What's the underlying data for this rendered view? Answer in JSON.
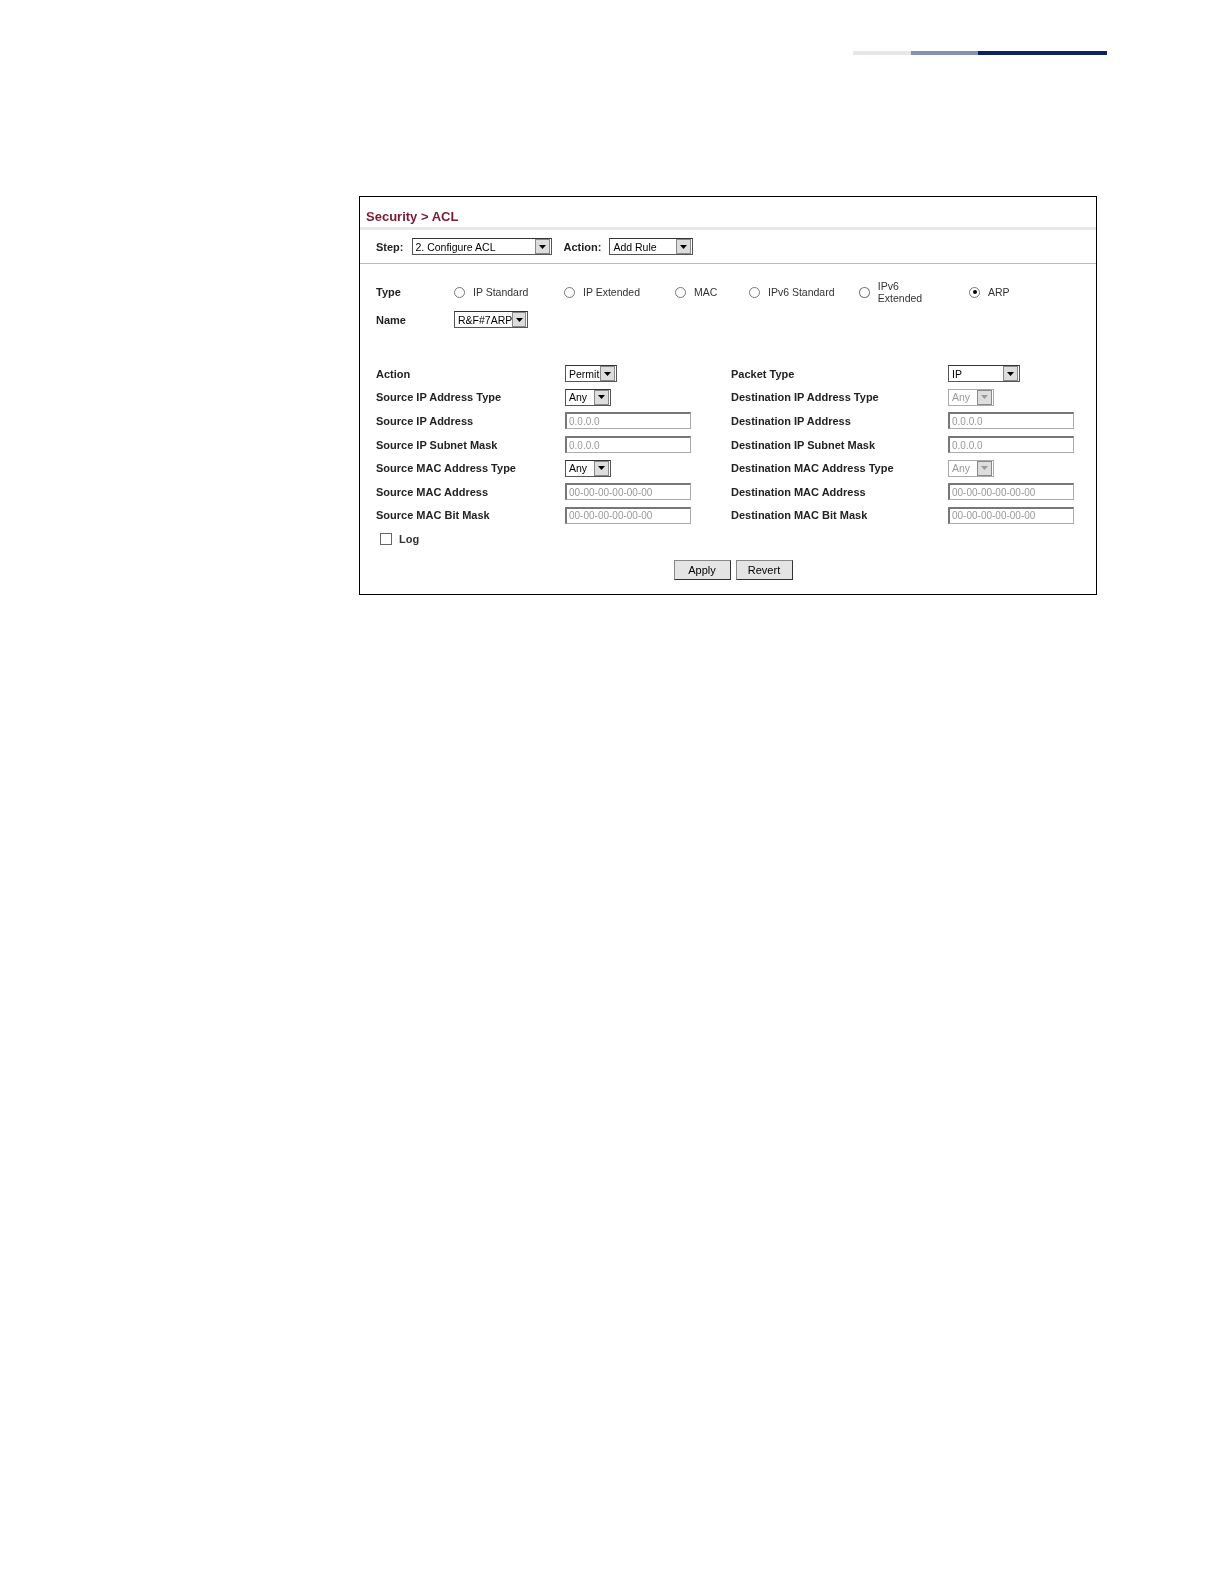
{
  "title": "Security > ACL",
  "step": {
    "label": "Step:",
    "value": "2. Configure ACL"
  },
  "action": {
    "label": "Action:",
    "value": "Add Rule"
  },
  "type": {
    "label": "Type",
    "options": [
      {
        "label": "IP Standard",
        "selected": false
      },
      {
        "label": "IP Extended",
        "selected": false
      },
      {
        "label": "MAC",
        "selected": false
      },
      {
        "label": "IPv6 Standard",
        "selected": false
      },
      {
        "label": "IPv6 Extended",
        "selected": false
      },
      {
        "label": "ARP",
        "selected": true
      }
    ]
  },
  "name": {
    "label": "Name",
    "value": "R&F#7ARP"
  },
  "left_fields": [
    {
      "label": "Action",
      "kind": "select",
      "value": "Permit",
      "disabled": false
    },
    {
      "label": "Source IP Address Type",
      "kind": "select",
      "value": "Any",
      "disabled": false
    },
    {
      "label": "Source IP Address",
      "kind": "text",
      "placeholder": "0.0.0.0"
    },
    {
      "label": "Source IP Subnet Mask",
      "kind": "text",
      "placeholder": "0.0.0.0"
    },
    {
      "label": "Source MAC Address Type",
      "kind": "select",
      "value": "Any",
      "disabled": false
    },
    {
      "label": "Source MAC Address",
      "kind": "text",
      "placeholder": "00-00-00-00-00-00"
    },
    {
      "label": "Source MAC Bit Mask",
      "kind": "text",
      "placeholder": "00-00-00-00-00-00"
    }
  ],
  "right_fields": [
    {
      "label": "Packet Type",
      "kind": "select",
      "value": "IP",
      "disabled": false
    },
    {
      "label": "Destination IP Address Type",
      "kind": "select",
      "value": "Any",
      "disabled": true
    },
    {
      "label": "Destination IP Address",
      "kind": "text",
      "placeholder": "0.0.0.0"
    },
    {
      "label": "Destination IP Subnet Mask",
      "kind": "text",
      "placeholder": "0.0.0.0"
    },
    {
      "label": "Destination MAC Address Type",
      "kind": "select",
      "value": "Any",
      "disabled": true
    },
    {
      "label": "Destination MAC Address",
      "kind": "text",
      "placeholder": "00-00-00-00-00-00"
    },
    {
      "label": "Destination MAC Bit Mask",
      "kind": "text",
      "placeholder": "00-00-00-00-00-00"
    }
  ],
  "log": {
    "label": "Log",
    "checked": false
  },
  "buttons": [
    "Apply",
    "Revert"
  ]
}
